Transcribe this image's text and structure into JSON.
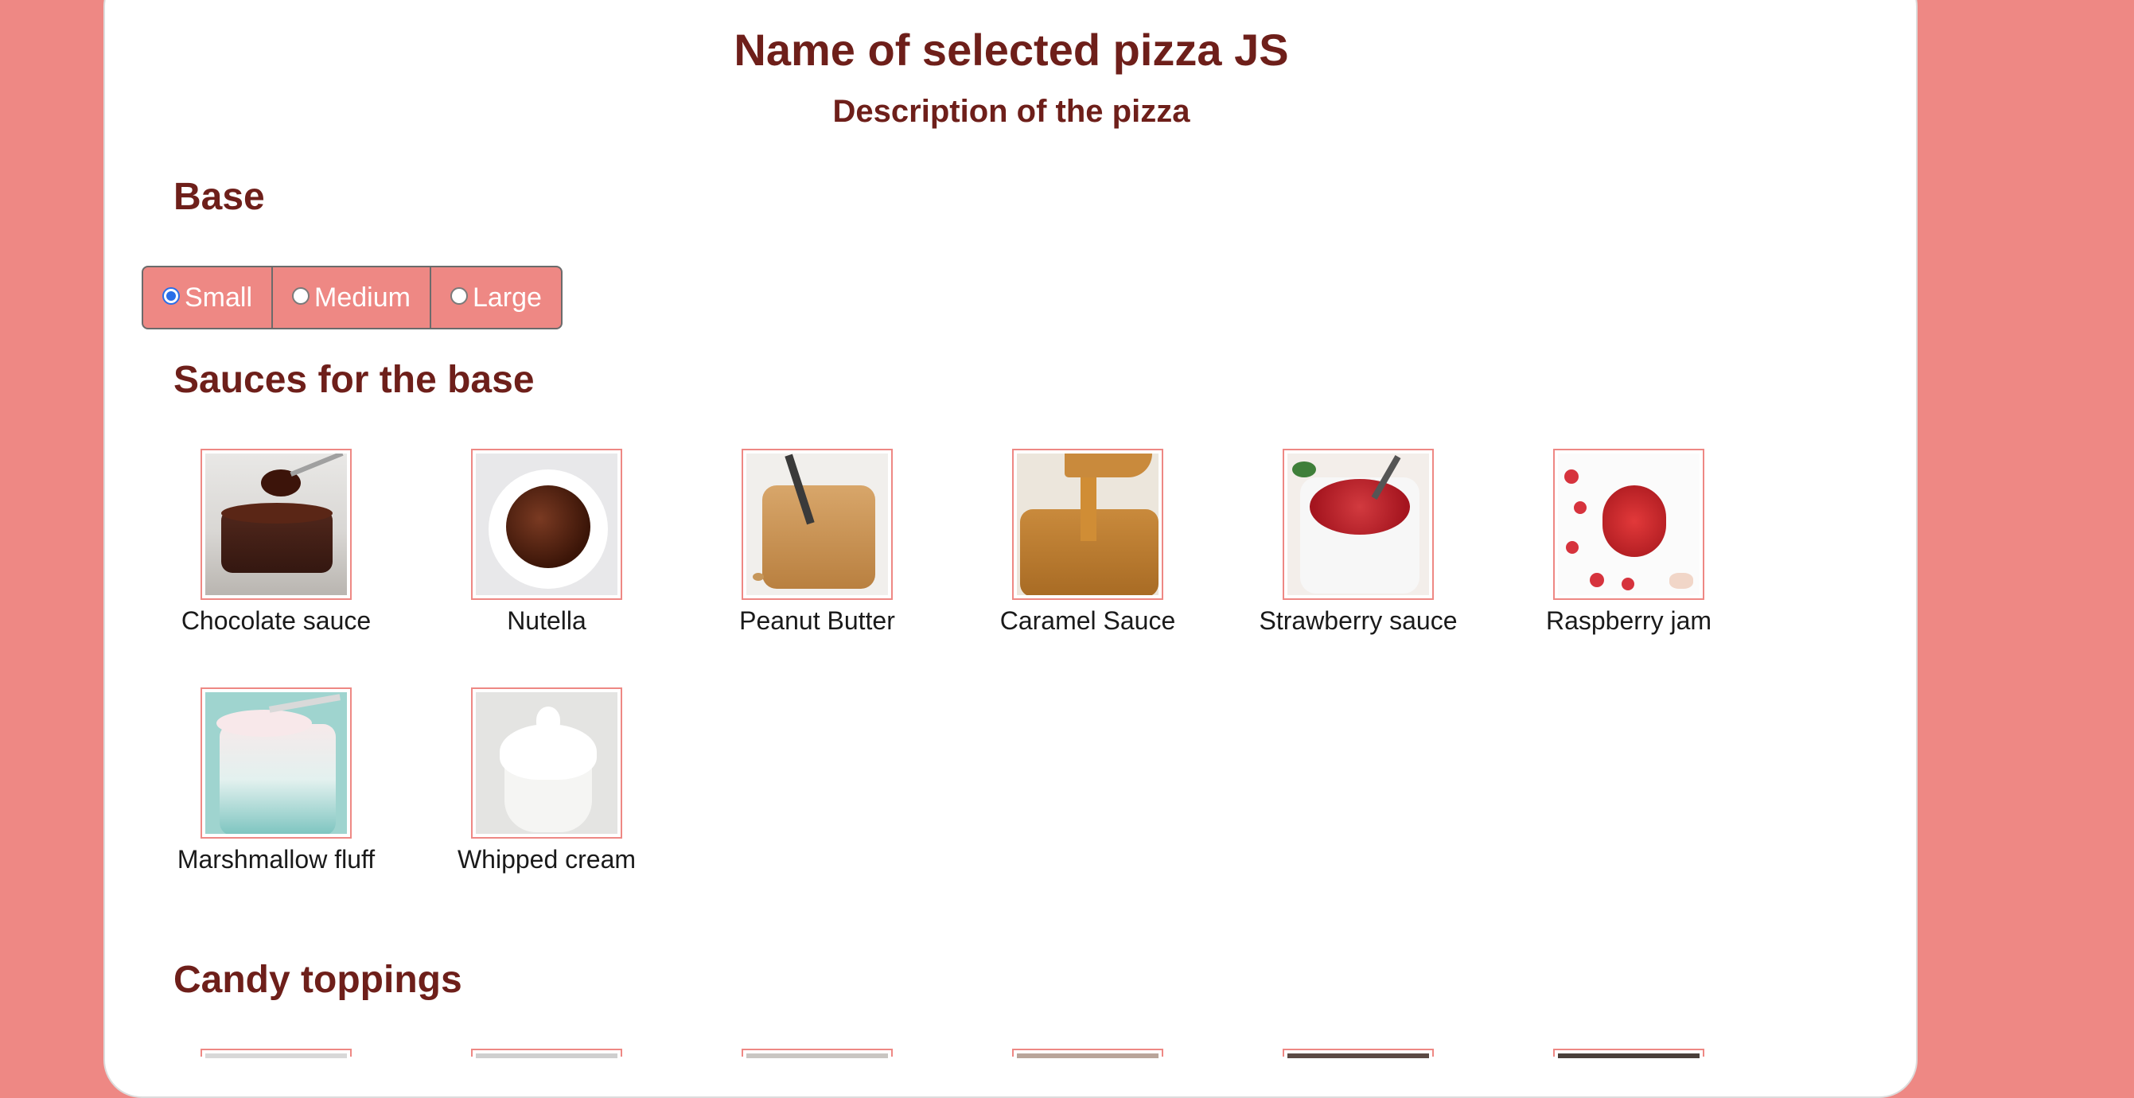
{
  "pizza": {
    "name": "Name of selected pizza JS",
    "description": "Description of the pizza"
  },
  "base": {
    "heading": "Base",
    "options": [
      {
        "label": "Small",
        "checked": true
      },
      {
        "label": "Medium",
        "checked": false
      },
      {
        "label": "Large",
        "checked": false
      }
    ]
  },
  "sauces": {
    "heading": "Sauces for the base",
    "items": [
      {
        "label": "Chocolate sauce",
        "image": "chocolate-sauce-image"
      },
      {
        "label": "Nutella",
        "image": "nutella-image"
      },
      {
        "label": "Peanut Butter",
        "image": "peanut-butter-image"
      },
      {
        "label": "Caramel Sauce",
        "image": "caramel-sauce-image"
      },
      {
        "label": "Strawberry sauce",
        "image": "strawberry-sauce-image"
      },
      {
        "label": "Raspberry jam",
        "image": "raspberry-jam-image"
      },
      {
        "label": "Marshmallow fluff",
        "image": "marshmallow-fluff-image"
      },
      {
        "label": "Whipped cream",
        "image": "whipped-cream-image"
      }
    ]
  },
  "candy": {
    "heading": "Candy toppings"
  },
  "colors": {
    "background": "#ee8884",
    "heading": "#6e1f1a",
    "card": "#ffffff"
  }
}
